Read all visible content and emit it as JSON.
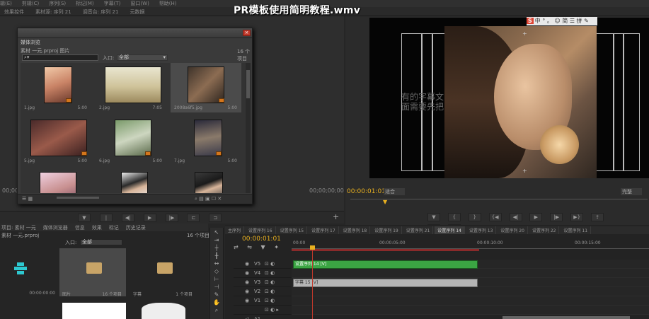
{
  "video_title": "PR模板使用简明教程.wmv",
  "menu": [
    "辑(E)",
    "剪辑(C)",
    "序列(S)",
    "标记(M)",
    "字幕(T)",
    "窗口(W)",
    "帮助(H)"
  ],
  "top_tabs": [
    "效果控件",
    "素材源: 序列 21",
    "调音台: 序列 21",
    "元数据"
  ],
  "left_panel": {
    "time_left": "00;00;00;00",
    "time_right": "00;00;00;00"
  },
  "float_window": {
    "tab": "媒体浏览",
    "path": "素材 一元.prproj 图片",
    "count": "16 个项目",
    "search_placeholder": "",
    "search_value": "",
    "in_label": "入口:",
    "in_value": "全部",
    "items": [
      {
        "name": "1.jpg",
        "dur": "5:00"
      },
      {
        "name": "2.jpg",
        "dur": "7:05"
      },
      {
        "name": "2008a6f5.jpg",
        "dur": "5:00"
      },
      {
        "name": "5.jpg",
        "dur": "5:00"
      },
      {
        "name": "6.jpg",
        "dur": "5:00"
      },
      {
        "name": "7.jpg",
        "dur": "5:00"
      },
      {
        "name": "",
        "dur": ""
      },
      {
        "name": "",
        "dur": ""
      },
      {
        "name": "",
        "dur": ""
      }
    ]
  },
  "program": {
    "overlay_text": "有的字幕文\n面需要先把",
    "time": "00:00:01:01",
    "fit_left": "适合",
    "fit_right": "完整",
    "ime": "中 ° 。 ☺ 简 ☰ 拼 ✎"
  },
  "project": {
    "tabs": [
      "项目: 素材 一元",
      "媒体浏览器",
      "信息",
      "效果",
      "标记",
      "历史记录"
    ],
    "file": "素材 一元.prproj",
    "count": "16 个项目",
    "in_label": "入口:",
    "in_value": "全部",
    "items": [
      {
        "label": "",
        "count": "00:00:00:00"
      },
      {
        "label": "图片",
        "count": "16 个项目"
      },
      {
        "label": "字幕",
        "count": "1 个项目"
      }
    ]
  },
  "timeline": {
    "tabs": [
      "主序列",
      "设置序列 16",
      "设置序列 15",
      "设置序列 17",
      "设置序列 18",
      "设置序列 19",
      "设置序列 21",
      "设置序列 14",
      "设置序列 13",
      "设置序列 20",
      "设置序列 22",
      "设置序列 11"
    ],
    "active_tab": 7,
    "time": "00:00:01:01",
    "ruler": [
      "00:00",
      "00:00:05:00",
      "00:00:10:00",
      "00:00:15:00"
    ],
    "tracks": [
      "V5",
      "V4",
      "V3",
      "V2",
      "V1",
      "A1"
    ],
    "clip_green": "设置序列 14 [V]",
    "clip_gray": "字幕 15 [V]"
  }
}
